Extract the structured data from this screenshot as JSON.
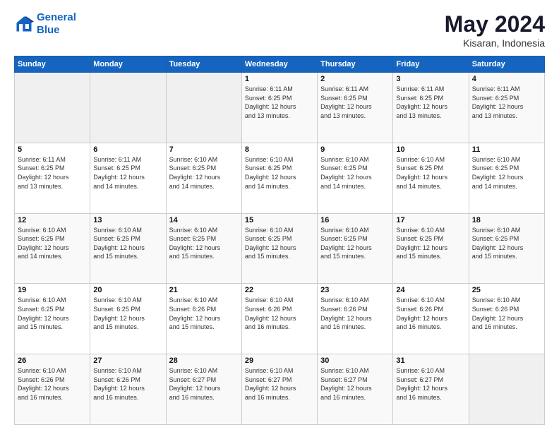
{
  "header": {
    "logo_line1": "General",
    "logo_line2": "Blue",
    "month_year": "May 2024",
    "location": "Kisaran, Indonesia"
  },
  "days_of_week": [
    "Sunday",
    "Monday",
    "Tuesday",
    "Wednesday",
    "Thursday",
    "Friday",
    "Saturday"
  ],
  "weeks": [
    [
      {
        "day": "",
        "info": ""
      },
      {
        "day": "",
        "info": ""
      },
      {
        "day": "",
        "info": ""
      },
      {
        "day": "1",
        "info": "Sunrise: 6:11 AM\nSunset: 6:25 PM\nDaylight: 12 hours\nand 13 minutes."
      },
      {
        "day": "2",
        "info": "Sunrise: 6:11 AM\nSunset: 6:25 PM\nDaylight: 12 hours\nand 13 minutes."
      },
      {
        "day": "3",
        "info": "Sunrise: 6:11 AM\nSunset: 6:25 PM\nDaylight: 12 hours\nand 13 minutes."
      },
      {
        "day": "4",
        "info": "Sunrise: 6:11 AM\nSunset: 6:25 PM\nDaylight: 12 hours\nand 13 minutes."
      }
    ],
    [
      {
        "day": "5",
        "info": "Sunrise: 6:11 AM\nSunset: 6:25 PM\nDaylight: 12 hours\nand 13 minutes."
      },
      {
        "day": "6",
        "info": "Sunrise: 6:11 AM\nSunset: 6:25 PM\nDaylight: 12 hours\nand 14 minutes."
      },
      {
        "day": "7",
        "info": "Sunrise: 6:10 AM\nSunset: 6:25 PM\nDaylight: 12 hours\nand 14 minutes."
      },
      {
        "day": "8",
        "info": "Sunrise: 6:10 AM\nSunset: 6:25 PM\nDaylight: 12 hours\nand 14 minutes."
      },
      {
        "day": "9",
        "info": "Sunrise: 6:10 AM\nSunset: 6:25 PM\nDaylight: 12 hours\nand 14 minutes."
      },
      {
        "day": "10",
        "info": "Sunrise: 6:10 AM\nSunset: 6:25 PM\nDaylight: 12 hours\nand 14 minutes."
      },
      {
        "day": "11",
        "info": "Sunrise: 6:10 AM\nSunset: 6:25 PM\nDaylight: 12 hours\nand 14 minutes."
      }
    ],
    [
      {
        "day": "12",
        "info": "Sunrise: 6:10 AM\nSunset: 6:25 PM\nDaylight: 12 hours\nand 14 minutes."
      },
      {
        "day": "13",
        "info": "Sunrise: 6:10 AM\nSunset: 6:25 PM\nDaylight: 12 hours\nand 15 minutes."
      },
      {
        "day": "14",
        "info": "Sunrise: 6:10 AM\nSunset: 6:25 PM\nDaylight: 12 hours\nand 15 minutes."
      },
      {
        "day": "15",
        "info": "Sunrise: 6:10 AM\nSunset: 6:25 PM\nDaylight: 12 hours\nand 15 minutes."
      },
      {
        "day": "16",
        "info": "Sunrise: 6:10 AM\nSunset: 6:25 PM\nDaylight: 12 hours\nand 15 minutes."
      },
      {
        "day": "17",
        "info": "Sunrise: 6:10 AM\nSunset: 6:25 PM\nDaylight: 12 hours\nand 15 minutes."
      },
      {
        "day": "18",
        "info": "Sunrise: 6:10 AM\nSunset: 6:25 PM\nDaylight: 12 hours\nand 15 minutes."
      }
    ],
    [
      {
        "day": "19",
        "info": "Sunrise: 6:10 AM\nSunset: 6:25 PM\nDaylight: 12 hours\nand 15 minutes."
      },
      {
        "day": "20",
        "info": "Sunrise: 6:10 AM\nSunset: 6:25 PM\nDaylight: 12 hours\nand 15 minutes."
      },
      {
        "day": "21",
        "info": "Sunrise: 6:10 AM\nSunset: 6:26 PM\nDaylight: 12 hours\nand 15 minutes."
      },
      {
        "day": "22",
        "info": "Sunrise: 6:10 AM\nSunset: 6:26 PM\nDaylight: 12 hours\nand 16 minutes."
      },
      {
        "day": "23",
        "info": "Sunrise: 6:10 AM\nSunset: 6:26 PM\nDaylight: 12 hours\nand 16 minutes."
      },
      {
        "day": "24",
        "info": "Sunrise: 6:10 AM\nSunset: 6:26 PM\nDaylight: 12 hours\nand 16 minutes."
      },
      {
        "day": "25",
        "info": "Sunrise: 6:10 AM\nSunset: 6:26 PM\nDaylight: 12 hours\nand 16 minutes."
      }
    ],
    [
      {
        "day": "26",
        "info": "Sunrise: 6:10 AM\nSunset: 6:26 PM\nDaylight: 12 hours\nand 16 minutes."
      },
      {
        "day": "27",
        "info": "Sunrise: 6:10 AM\nSunset: 6:26 PM\nDaylight: 12 hours\nand 16 minutes."
      },
      {
        "day": "28",
        "info": "Sunrise: 6:10 AM\nSunset: 6:27 PM\nDaylight: 12 hours\nand 16 minutes."
      },
      {
        "day": "29",
        "info": "Sunrise: 6:10 AM\nSunset: 6:27 PM\nDaylight: 12 hours\nand 16 minutes."
      },
      {
        "day": "30",
        "info": "Sunrise: 6:10 AM\nSunset: 6:27 PM\nDaylight: 12 hours\nand 16 minutes."
      },
      {
        "day": "31",
        "info": "Sunrise: 6:10 AM\nSunset: 6:27 PM\nDaylight: 12 hours\nand 16 minutes."
      },
      {
        "day": "",
        "info": ""
      }
    ]
  ]
}
